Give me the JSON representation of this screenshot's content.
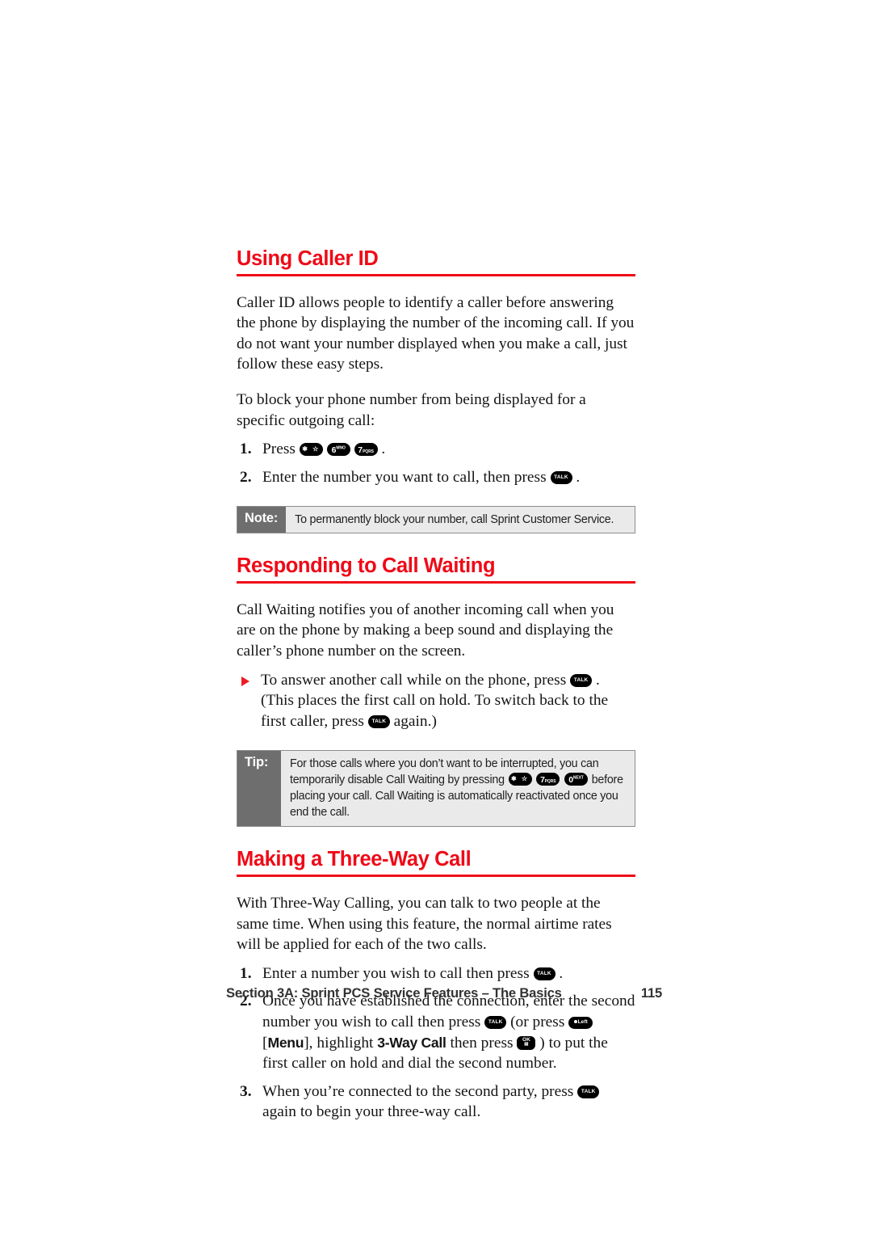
{
  "page": {
    "number": "115",
    "footer_section": "Section 3A: Sprint PCS Service Features – The Basics",
    "accent_color": "#ef0a17",
    "callout_label_bg": "#6e6e6e",
    "callout_body_bg": "#eaeaea"
  },
  "sections": {
    "caller_id": {
      "heading": "Using Caller ID",
      "para1": "Caller ID allows people to identify a caller before answering the phone by displaying the number of the incoming call. If you do not want your number displayed when you make a call, just follow these easy steps.",
      "para2": "To block your phone number from being displayed for a specific outgoing call:",
      "step1_num": "1.",
      "step1_pre": "Press",
      "step1_post": ".",
      "step2_num": "2.",
      "step2_pre": "Enter the number you want to call, then press",
      "step2_post": "."
    },
    "note": {
      "label": "Note:",
      "text": "To permanently block your number, call Sprint Customer Service."
    },
    "call_waiting": {
      "heading": "Responding to Call Waiting",
      "para1": "Call Waiting notifies you of another incoming call when you are on the phone by making a beep sound and displaying the caller’s phone number on the screen.",
      "bullet_pre": "To answer another call while on the phone, press",
      "bullet_mid": ". (This places the first call on hold. To switch back to the first caller, press",
      "bullet_post": "again.)"
    },
    "tip": {
      "label": "Tip:",
      "text_pre": "For those calls where you don’t want to be interrupted, you can temporarily disable Call Waiting by pressing",
      "text_post": "before placing your call. Call Waiting is automatically reactivated once you end the call."
    },
    "three_way": {
      "heading": "Making a Three-Way Call",
      "para1": "With Three-Way Calling, you can talk to two people at the same time. When using this feature, the normal airtime rates will be applied for each of the two calls.",
      "step1_num": "1.",
      "step1_pre": "Enter a number you wish to call then press",
      "step1_post": ".",
      "step2_num": "2.",
      "step2_a": "Once you have established the connection, enter the second number you wish to call then press",
      "step2_b": "(or press",
      "step2_c": "[",
      "step2_menu": "Menu",
      "step2_d": "], highlight",
      "step2_bold": "3-Way Call",
      "step2_e": "then press",
      "step2_f": ") to put the first caller on hold and dial the second number.",
      "step3_num": "3.",
      "step3_pre": "When you’re connected to the second party, press",
      "step3_post": "again to begin your three-way call."
    }
  },
  "keys": {
    "talk": "TALK",
    "star": "✱ ☆",
    "six": "6",
    "six_sup": "MNO",
    "seven": "7",
    "seven_sub": "PQRS",
    "zero": "0",
    "zero_sup": "NEXT",
    "left_soft": "Left",
    "ok": "OK",
    "ok_sub": "▤"
  }
}
